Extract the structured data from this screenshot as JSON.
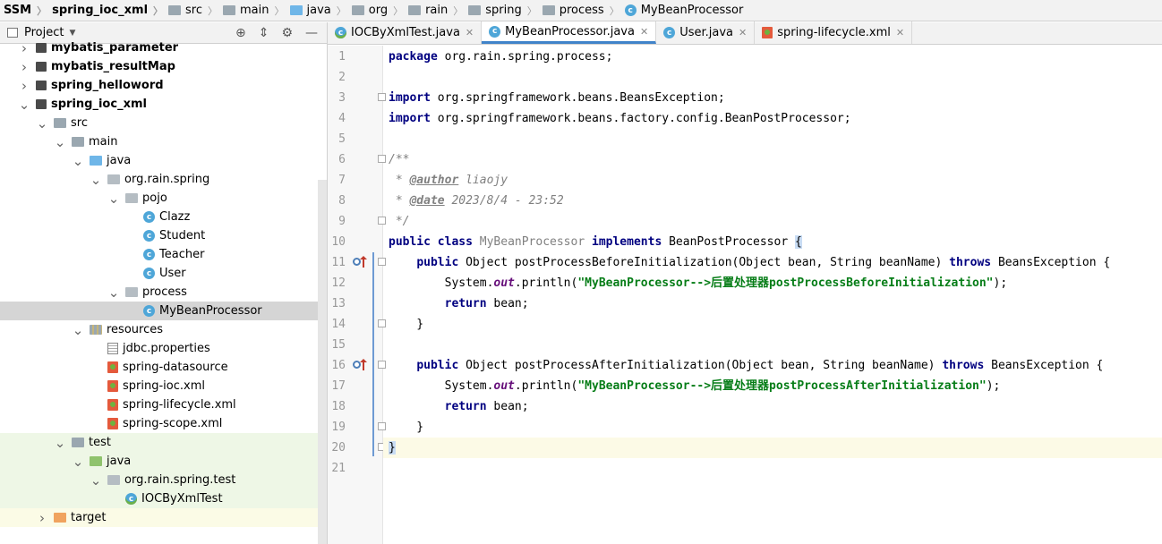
{
  "breadcrumb": [
    {
      "label": "SSM",
      "bold": true,
      "icon": "module"
    },
    {
      "label": "spring_ioc_xml",
      "bold": true,
      "icon": "module"
    },
    {
      "label": "src",
      "icon": "folder"
    },
    {
      "label": "main",
      "icon": "folder"
    },
    {
      "label": "java",
      "icon": "folder-blue"
    },
    {
      "label": "org",
      "icon": "folder"
    },
    {
      "label": "rain",
      "icon": "folder"
    },
    {
      "label": "spring",
      "icon": "folder"
    },
    {
      "label": "process",
      "icon": "folder"
    },
    {
      "label": "MyBeanProcessor",
      "icon": "class"
    }
  ],
  "project_panel": {
    "title": "Project",
    "tree": [
      {
        "label": "mybatis_parameter",
        "level": 1,
        "arrow": "right",
        "icon": "module",
        "bold": true
      },
      {
        "label": "mybatis_resultMap",
        "level": 1,
        "arrow": "right",
        "icon": "module",
        "bold": true
      },
      {
        "label": "spring_helloword",
        "level": 1,
        "arrow": "right",
        "icon": "module",
        "bold": true
      },
      {
        "label": "spring_ioc_xml",
        "level": 1,
        "arrow": "down",
        "icon": "module",
        "bold": true
      },
      {
        "label": "src",
        "level": 2,
        "arrow": "down",
        "icon": "folder"
      },
      {
        "label": "main",
        "level": 3,
        "arrow": "down",
        "icon": "folder"
      },
      {
        "label": "java",
        "level": 4,
        "arrow": "down",
        "icon": "folder-blue"
      },
      {
        "label": "org.rain.spring",
        "level": 5,
        "arrow": "down",
        "icon": "package"
      },
      {
        "label": "pojo",
        "level": 6,
        "arrow": "down",
        "icon": "package"
      },
      {
        "label": "Clazz",
        "level": 7,
        "arrow": "none",
        "icon": "class"
      },
      {
        "label": "Student",
        "level": 7,
        "arrow": "none",
        "icon": "class"
      },
      {
        "label": "Teacher",
        "level": 7,
        "arrow": "none",
        "icon": "class"
      },
      {
        "label": "User",
        "level": 7,
        "arrow": "none",
        "icon": "class"
      },
      {
        "label": "process",
        "level": 6,
        "arrow": "down",
        "icon": "package"
      },
      {
        "label": "MyBeanProcessor",
        "level": 7,
        "arrow": "none",
        "icon": "class",
        "selected": true
      },
      {
        "label": "resources",
        "level": 4,
        "arrow": "down",
        "icon": "folder-res"
      },
      {
        "label": "jdbc.properties",
        "level": 5,
        "arrow": "none",
        "icon": "properties"
      },
      {
        "label": "spring-datasource",
        "level": 5,
        "arrow": "none",
        "icon": "xml"
      },
      {
        "label": "spring-ioc.xml",
        "level": 5,
        "arrow": "none",
        "icon": "xml"
      },
      {
        "label": "spring-lifecycle.xml",
        "level": 5,
        "arrow": "none",
        "icon": "xml"
      },
      {
        "label": "spring-scope.xml",
        "level": 5,
        "arrow": "none",
        "icon": "xml"
      },
      {
        "label": "test",
        "level": 3,
        "arrow": "down",
        "icon": "folder",
        "bg": "test"
      },
      {
        "label": "java",
        "level": 4,
        "arrow": "down",
        "icon": "folder-green",
        "bg": "test"
      },
      {
        "label": "org.rain.spring.test",
        "level": 5,
        "arrow": "down",
        "icon": "package",
        "bg": "test"
      },
      {
        "label": "IOCByXmlTest",
        "level": 6,
        "arrow": "none",
        "icon": "test-class",
        "bg": "test"
      },
      {
        "label": "target",
        "level": 2,
        "arrow": "right",
        "icon": "folder-orange",
        "bg": "target"
      }
    ]
  },
  "tabs": [
    {
      "label": "IOCByXmlTest.java",
      "icon": "test-class",
      "active": false
    },
    {
      "label": "MyBeanProcessor.java",
      "icon": "class",
      "active": true
    },
    {
      "label": "User.java",
      "icon": "class",
      "active": false
    },
    {
      "label": "spring-lifecycle.xml",
      "icon": "xml",
      "active": false
    }
  ],
  "editor": {
    "line_numbers": [
      "1",
      "2",
      "3",
      "4",
      "5",
      "6",
      "7",
      "8",
      "9",
      "10",
      "11",
      "12",
      "13",
      "14",
      "15",
      "16",
      "17",
      "18",
      "19",
      "20",
      "21"
    ],
    "lines": [
      [
        {
          "t": "package",
          "c": "kw"
        },
        {
          "t": " org.rain.spring.process;"
        }
      ],
      [],
      [
        {
          "t": "import",
          "c": "kw"
        },
        {
          "t": " org.springframework.beans.BeansException;"
        }
      ],
      [
        {
          "t": "import",
          "c": "kw"
        },
        {
          "t": " org.springframework.beans.factory.config.BeanPostProcessor;"
        }
      ],
      [],
      [
        {
          "t": "/**",
          "c": "cmt"
        }
      ],
      [
        {
          "t": " * ",
          "c": "cmt"
        },
        {
          "t": "@author",
          "c": "tag"
        },
        {
          "t": " liaojy",
          "c": "cmt"
        }
      ],
      [
        {
          "t": " * ",
          "c": "cmt"
        },
        {
          "t": "@date",
          "c": "tag"
        },
        {
          "t": " 2023/8/4 - 23:52",
          "c": "cmt"
        }
      ],
      [
        {
          "t": " */",
          "c": "cmt"
        }
      ],
      [
        {
          "t": "public",
          "c": "kw"
        },
        {
          "t": " "
        },
        {
          "t": "class",
          "c": "kw"
        },
        {
          "t": " "
        },
        {
          "t": "MyBeanProcessor",
          "c": "cls"
        },
        {
          "t": " "
        },
        {
          "t": "implements",
          "c": "kw"
        },
        {
          "t": " BeanPostProcessor "
        },
        {
          "t": "{",
          "c": "brace-hl"
        }
      ],
      [
        {
          "t": "    "
        },
        {
          "t": "public",
          "c": "kw"
        },
        {
          "t": " Object postProcessBeforeInitialization(Object bean, String beanName) "
        },
        {
          "t": "throws",
          "c": "kw"
        },
        {
          "t": " BeansException {"
        }
      ],
      [
        {
          "t": "        System."
        },
        {
          "t": "out",
          "c": "fld"
        },
        {
          "t": ".println("
        },
        {
          "t": "\"MyBeanProcessor-->后置处理器postProcessBeforeInitialization\"",
          "c": "str"
        },
        {
          "t": ");"
        }
      ],
      [
        {
          "t": "        "
        },
        {
          "t": "return",
          "c": "kw"
        },
        {
          "t": " bean;"
        }
      ],
      [
        {
          "t": "    }"
        }
      ],
      [],
      [
        {
          "t": "    "
        },
        {
          "t": "public",
          "c": "kw"
        },
        {
          "t": " Object postProcessAfterInitialization(Object bean, String beanName) "
        },
        {
          "t": "throws",
          "c": "kw"
        },
        {
          "t": " BeansException {"
        }
      ],
      [
        {
          "t": "        System."
        },
        {
          "t": "out",
          "c": "fld"
        },
        {
          "t": ".println("
        },
        {
          "t": "\"MyBeanProcessor-->后置处理器postProcessAfterInitialization\"",
          "c": "str"
        },
        {
          "t": ");"
        }
      ],
      [
        {
          "t": "        "
        },
        {
          "t": "return",
          "c": "kw"
        },
        {
          "t": " bean;"
        }
      ],
      [
        {
          "t": "    }"
        }
      ],
      [
        {
          "t": "}",
          "c": "brace-hl"
        }
      ],
      []
    ]
  }
}
